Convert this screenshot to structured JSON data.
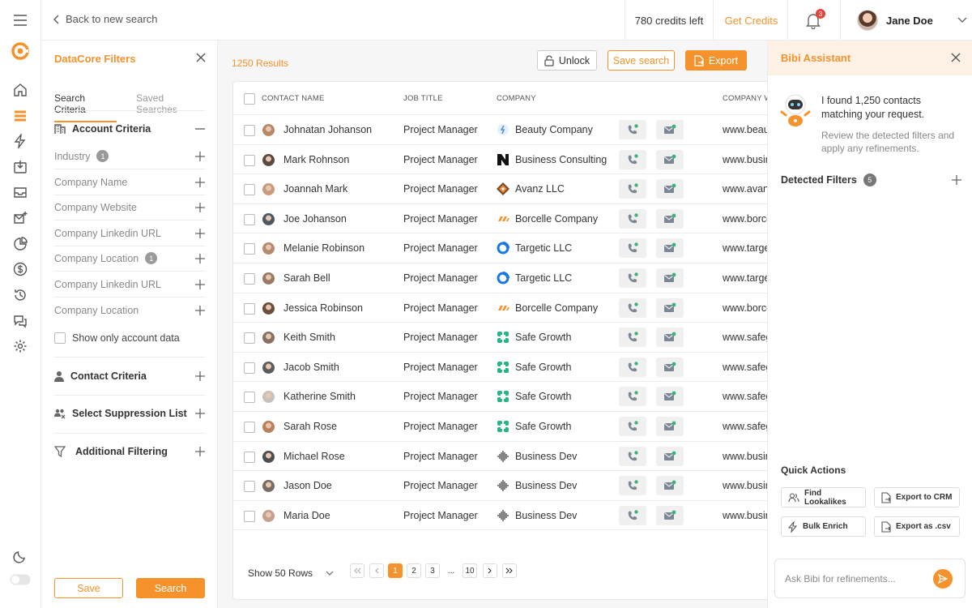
{
  "colors": {
    "accent": "#f5922b",
    "badge": "#e5433a",
    "status_dot": "#3cb37a"
  },
  "topbar": {
    "back_label": "Back to new search",
    "credits": "780 credits left",
    "get_credits": "Get Credits",
    "notifications_count": "3",
    "user_name": "Jane Doe"
  },
  "filters": {
    "title": "DataCore Filters",
    "tabs": [
      "Search Criteria",
      "Saved Searches"
    ],
    "account_criteria": "Account Criteria",
    "fields": [
      {
        "label": "Industry",
        "count": "1"
      },
      {
        "label": "Company Name",
        "count": ""
      },
      {
        "label": "Company Website",
        "count": ""
      },
      {
        "label": "Company Linkedin URL",
        "count": ""
      },
      {
        "label": "Company Location",
        "count": "1"
      },
      {
        "label": "Company Linkedin URL",
        "count": ""
      },
      {
        "label": "Company Location",
        "count": ""
      }
    ],
    "show_only_account": "Show only account data",
    "contact_criteria": "Contact Criteria",
    "suppression": "Select Suppression List",
    "additional": "Additional Filtering",
    "save": "Save",
    "search": "Search"
  },
  "main": {
    "results": "1250 Results",
    "unlock": "Unlock",
    "save_search": "Save search",
    "export": "Export",
    "columns": [
      "CONTACT NAME",
      "JOB TITLE",
      "COMPANY",
      "COMPANY W"
    ],
    "rows": [
      {
        "name": "Johnatan Johanson",
        "title": "Project Manager",
        "company": "Beauty Company",
        "logo": "beauty-logo",
        "web": "www.beaut"
      },
      {
        "name": "Mark Rohnson",
        "title": "Project Manager",
        "company": "Business Consulting",
        "logo": "n-logo",
        "web": "www.busin"
      },
      {
        "name": "Joannah Mark",
        "title": "Project Manager",
        "company": "Avanz  LLC",
        "logo": "avanz-logo",
        "web": "www.avanz"
      },
      {
        "name": "Joe Johanson",
        "title": "Project Manager",
        "company": "Borcelle Company",
        "logo": "borcelle-logo",
        "web": "www.borce"
      },
      {
        "name": "Melanie Robinson",
        "title": "Project Manager",
        "company": "Targetic LLC",
        "logo": "targetic-logo",
        "web": "www.targe"
      },
      {
        "name": "Sarah Bell",
        "title": "Project Manager",
        "company": "Targetic LLC",
        "logo": "targetic-logo",
        "web": "www.targe"
      },
      {
        "name": "Jessica Robinson",
        "title": "Project Manager",
        "company": "Borcelle Company",
        "logo": "borcelle-logo",
        "web": "www.borce"
      },
      {
        "name": "Keith Smith",
        "title": "Project Manager",
        "company": "Safe Growth",
        "logo": "safe-growth-logo",
        "web": "www.safeg"
      },
      {
        "name": "Jacob Smith",
        "title": "Project Manager",
        "company": "Safe Growth",
        "logo": "safe-growth-logo",
        "web": "www.safeg"
      },
      {
        "name": "Katherine Smith",
        "title": "Project Manager",
        "company": "Safe Growth",
        "logo": "safe-growth-logo",
        "web": "www.safeg"
      },
      {
        "name": "Sarah Rose",
        "title": "Project Manager",
        "company": "Safe Growth",
        "logo": "safe-growth-logo",
        "web": "www.safeg"
      },
      {
        "name": "Michael Rose",
        "title": "Project Manager",
        "company": "Business Dev",
        "logo": "business-dev-logo",
        "web": "www.busin"
      },
      {
        "name": "Jason Doe",
        "title": "Project Manager",
        "company": "Business Dev",
        "logo": "business-dev-logo",
        "web": "www.busin"
      },
      {
        "name": "Maria Doe",
        "title": "Project Manager",
        "company": "Business Dev",
        "logo": "business-dev-logo",
        "web": "www.busin"
      }
    ],
    "pagination": {
      "show_rows": "Show 50 Rows",
      "pages": [
        "1",
        "2",
        "3",
        "...",
        "10"
      ],
      "current": "1"
    }
  },
  "assistant": {
    "title": "Bibi Assistant",
    "message": "I found 1,250 contacts matching your request.",
    "sub": "Review the detected filters and apply any refinements.",
    "detected_filters": "Detected Filters",
    "detected_count": "5",
    "quick_actions_title": "Quick Actions",
    "quick_actions": [
      "Find Lookalikes",
      "Export to CRM",
      "Bulk Enrich",
      "Export as .csv"
    ],
    "ask_placeholder": "Ask Bibi for refinements..."
  }
}
